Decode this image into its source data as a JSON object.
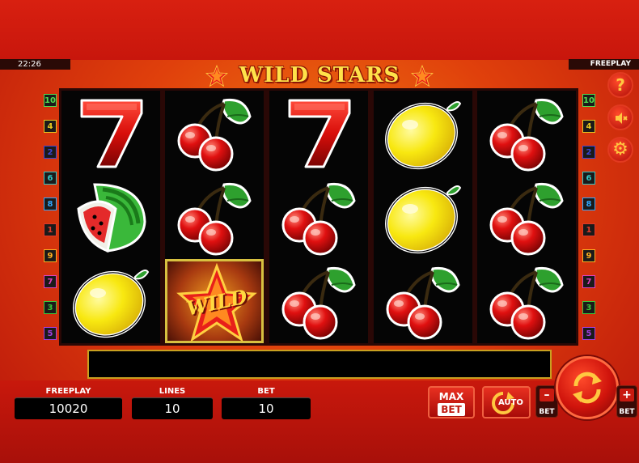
{
  "clock": "22:26",
  "mode_label": "FREEPLAY",
  "game_title": "WILD STARS",
  "paylines": {
    "left": [
      "10",
      "4",
      "2",
      "6",
      "8",
      "1",
      "9",
      "7",
      "3",
      "5"
    ],
    "right": [
      "10",
      "4",
      "2",
      "6",
      "8",
      "1",
      "9",
      "7",
      "3",
      "5"
    ]
  },
  "reels": [
    [
      "seven",
      "watermelon",
      "lemon"
    ],
    [
      "cherries",
      "cherries",
      "wild"
    ],
    [
      "seven",
      "cherries",
      "cherries"
    ],
    [
      "lemon",
      "lemon",
      "cherries"
    ],
    [
      "cherries",
      "cherries",
      "cherries"
    ]
  ],
  "wild_text": "WILD",
  "message": "",
  "freeplay": {
    "label": "FREEPLAY",
    "value": "10020"
  },
  "lines": {
    "label": "LINES",
    "value": "10"
  },
  "bet": {
    "label": "BET",
    "value": "10"
  },
  "buttons": {
    "max_bet_line1": "MAX",
    "max_bet_line2": "BET",
    "auto": "AUTO",
    "bet_minus_sign": "–",
    "bet_minus_label": "BET",
    "bet_plus_sign": "+",
    "bet_plus_label": "BET"
  },
  "icons": {
    "help": "?",
    "sound": "speaker-muted-icon",
    "settings": "gear-icon"
  },
  "badge_colors": {
    "1": "#e03a2a",
    "2": "#3a48d8",
    "3": "#3ac83a",
    "4": "#e8c820",
    "5": "#a040e0",
    "6": "#30c8c8",
    "7": "#e040c0",
    "8": "#30a8ff",
    "9": "#ffb020",
    "10": "#50e050"
  }
}
